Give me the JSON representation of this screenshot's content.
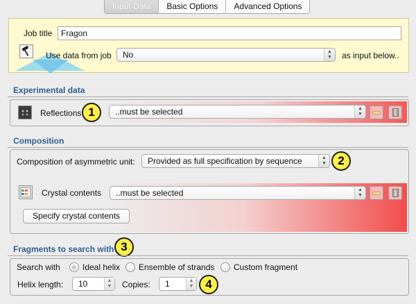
{
  "tabs": [
    {
      "label": "Input Data",
      "active": true
    },
    {
      "label": "Basic Options",
      "active": false
    },
    {
      "label": "Advanced Options",
      "active": false
    }
  ],
  "header": {
    "job_title_label": "Job title",
    "job_title_value": "Fragon",
    "use_data_label": "Use data from job",
    "use_data_value": "No",
    "input_below_label": "as input below.."
  },
  "experimental": {
    "section_title": "Experimental data",
    "reflections_label": "Reflections",
    "reflections_value": "..must be selected",
    "badge": "1"
  },
  "composition": {
    "section_title": "Composition",
    "asym_label": "Composition of asymmetric unit:",
    "asym_value": "Provided as full specification by sequence",
    "badge": "2",
    "crystal_label": "Crystal contents",
    "crystal_value": "..must be selected",
    "specify_button": "Specify crystal contents"
  },
  "fragments": {
    "section_title": "Fragments to search with",
    "badge": "3",
    "search_with_label": "Search with",
    "options": [
      {
        "label": "Ideal helix",
        "selected": true
      },
      {
        "label": "Ensemble of strands",
        "selected": false
      },
      {
        "label": "Custom fragment",
        "selected": false
      }
    ],
    "helix_length_label": "Helix length:",
    "helix_length_value": "10",
    "copies_label": "Copies:",
    "copies_value": "1",
    "badge4": "4"
  },
  "colors": {
    "section_title": "#2e5e93",
    "header_bg": "#fffacf",
    "required_red": "#f25a5a",
    "badge_fill": "#fff14a"
  },
  "icons": {
    "hammer": "hammer-icon",
    "reflections": "reflections-icon",
    "crystal": "crystal-contents-icon",
    "view": "view-data-icon",
    "database": "database-icon"
  }
}
